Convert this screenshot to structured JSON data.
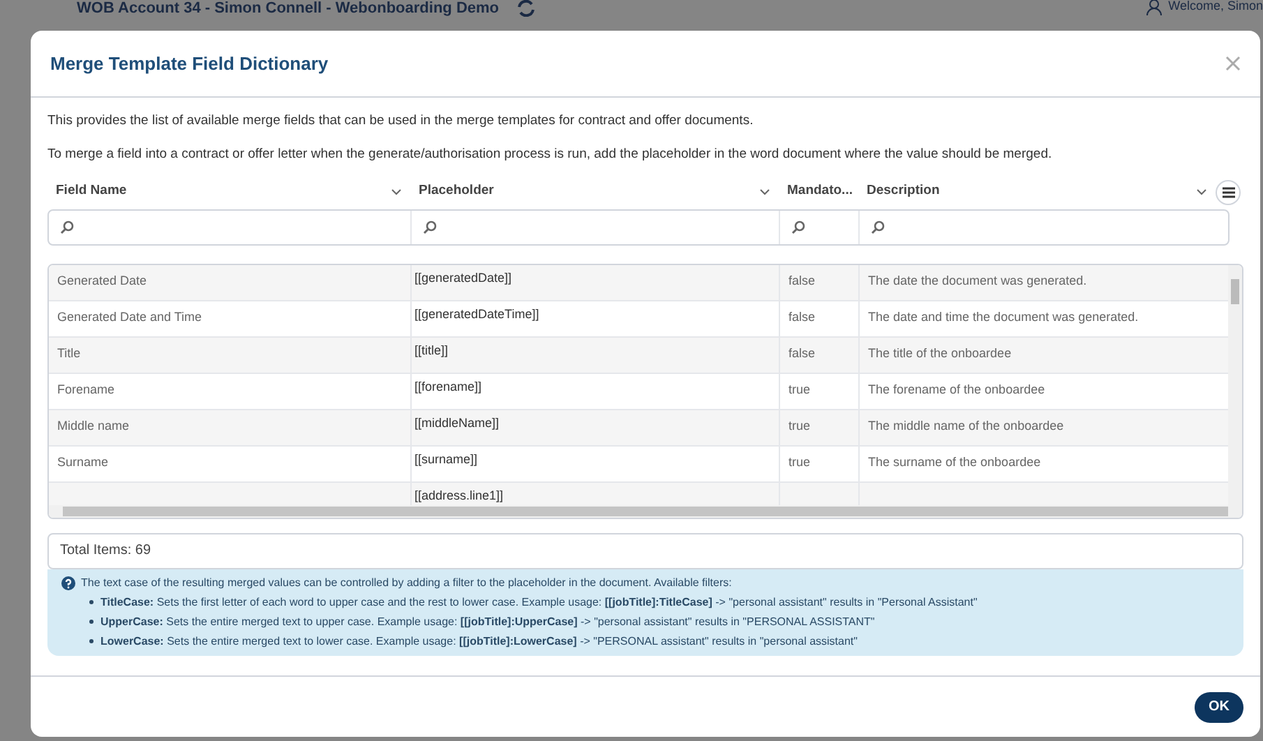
{
  "app_bar": {
    "title": "WOB Account 34 - Simon Connell - Webonboarding Demo",
    "welcome": "Welcome, Simon"
  },
  "dialog": {
    "title": "Merge Template Field Dictionary",
    "intro": [
      "This provides the list of available merge fields that can be used in the merge templates for contract and offer documents.",
      "To merge a field into a contract or offer letter when the generate/authorisation process is run, add the placeholder in the word document where the value should be merged."
    ],
    "table": {
      "columns": [
        {
          "label": "Field Name"
        },
        {
          "label": "Placeholder"
        },
        {
          "label": "Mandato..."
        },
        {
          "label": "Description"
        }
      ],
      "rows": [
        {
          "field_name": "Generated Date",
          "placeholder": "[[generatedDate]]",
          "mandatory": "false",
          "description": "The date the document was generated."
        },
        {
          "field_name": "Generated Date and Time",
          "placeholder": "[[generatedDateTime]]",
          "mandatory": "false",
          "description": "The date and time the document was generated."
        },
        {
          "field_name": "Title",
          "placeholder": "[[title]]",
          "mandatory": "false",
          "description": "The title of the onboardee"
        },
        {
          "field_name": "Forename",
          "placeholder": "[[forename]]",
          "mandatory": "true",
          "description": "The forename of the onboardee"
        },
        {
          "field_name": "Middle name",
          "placeholder": "[[middleName]]",
          "mandatory": "true",
          "description": "The middle name of the onboardee"
        },
        {
          "field_name": "Surname",
          "placeholder": "[[surname]]",
          "mandatory": "true",
          "description": "The surname of the onboardee"
        },
        {
          "placeholder": "[[address.line1]]"
        }
      ],
      "total": "Total Items: 69"
    },
    "info": {
      "text": "The text case of the resulting merged values can be controlled by adding a filter to the placeholder in the document. Available filters:",
      "filters": [
        "**TitleCase:** Sets the first letter of each word to upper case and the rest to lower case. Example usage: **[[jobTitle]:TitleCase]** -> \"personal assistant\" results in \"Personal Assistant\"",
        "**UpperCase:** Sets the entire merged text to upper case. Example usage: **[[jobTitle]:UpperCase]** -> \"personal assistant\" results in \"PERSONAL ASSISTANT\"",
        "**LowerCase:** Sets the entire merged text to lower case. Example usage: **[[jobTitle]:LowerCase]** -> \"PERSONAL assistant\" results in \"personal assistant\""
      ]
    },
    "buttons": [
      "OK"
    ]
  }
}
